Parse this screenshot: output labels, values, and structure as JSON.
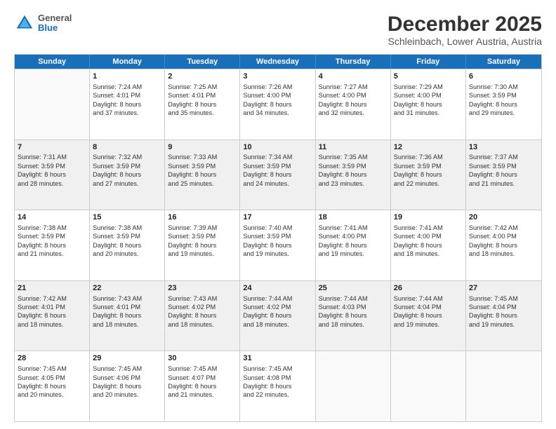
{
  "logo": {
    "general": "General",
    "blue": "Blue"
  },
  "title": "December 2025",
  "subtitle": "Schleinbach, Lower Austria, Austria",
  "weekdays": [
    "Sunday",
    "Monday",
    "Tuesday",
    "Wednesday",
    "Thursday",
    "Friday",
    "Saturday"
  ],
  "rows": [
    [
      {
        "day": "",
        "sunrise": "",
        "sunset": "",
        "daylight": "",
        "empty": true
      },
      {
        "day": "1",
        "sunrise": "Sunrise: 7:24 AM",
        "sunset": "Sunset: 4:01 PM",
        "daylight": "Daylight: 8 hours",
        "daylight2": "and 37 minutes."
      },
      {
        "day": "2",
        "sunrise": "Sunrise: 7:25 AM",
        "sunset": "Sunset: 4:01 PM",
        "daylight": "Daylight: 8 hours",
        "daylight2": "and 35 minutes."
      },
      {
        "day": "3",
        "sunrise": "Sunrise: 7:26 AM",
        "sunset": "Sunset: 4:00 PM",
        "daylight": "Daylight: 8 hours",
        "daylight2": "and 34 minutes."
      },
      {
        "day": "4",
        "sunrise": "Sunrise: 7:27 AM",
        "sunset": "Sunset: 4:00 PM",
        "daylight": "Daylight: 8 hours",
        "daylight2": "and 32 minutes."
      },
      {
        "day": "5",
        "sunrise": "Sunrise: 7:29 AM",
        "sunset": "Sunset: 4:00 PM",
        "daylight": "Daylight: 8 hours",
        "daylight2": "and 31 minutes."
      },
      {
        "day": "6",
        "sunrise": "Sunrise: 7:30 AM",
        "sunset": "Sunset: 3:59 PM",
        "daylight": "Daylight: 8 hours",
        "daylight2": "and 29 minutes."
      }
    ],
    [
      {
        "day": "7",
        "sunrise": "Sunrise: 7:31 AM",
        "sunset": "Sunset: 3:59 PM",
        "daylight": "Daylight: 8 hours",
        "daylight2": "and 28 minutes."
      },
      {
        "day": "8",
        "sunrise": "Sunrise: 7:32 AM",
        "sunset": "Sunset: 3:59 PM",
        "daylight": "Daylight: 8 hours",
        "daylight2": "and 27 minutes."
      },
      {
        "day": "9",
        "sunrise": "Sunrise: 7:33 AM",
        "sunset": "Sunset: 3:59 PM",
        "daylight": "Daylight: 8 hours",
        "daylight2": "and 25 minutes."
      },
      {
        "day": "10",
        "sunrise": "Sunrise: 7:34 AM",
        "sunset": "Sunset: 3:59 PM",
        "daylight": "Daylight: 8 hours",
        "daylight2": "and 24 minutes."
      },
      {
        "day": "11",
        "sunrise": "Sunrise: 7:35 AM",
        "sunset": "Sunset: 3:59 PM",
        "daylight": "Daylight: 8 hours",
        "daylight2": "and 23 minutes."
      },
      {
        "day": "12",
        "sunrise": "Sunrise: 7:36 AM",
        "sunset": "Sunset: 3:59 PM",
        "daylight": "Daylight: 8 hours",
        "daylight2": "and 22 minutes."
      },
      {
        "day": "13",
        "sunrise": "Sunrise: 7:37 AM",
        "sunset": "Sunset: 3:59 PM",
        "daylight": "Daylight: 8 hours",
        "daylight2": "and 21 minutes."
      }
    ],
    [
      {
        "day": "14",
        "sunrise": "Sunrise: 7:38 AM",
        "sunset": "Sunset: 3:59 PM",
        "daylight": "Daylight: 8 hours",
        "daylight2": "and 21 minutes."
      },
      {
        "day": "15",
        "sunrise": "Sunrise: 7:38 AM",
        "sunset": "Sunset: 3:59 PM",
        "daylight": "Daylight: 8 hours",
        "daylight2": "and 20 minutes."
      },
      {
        "day": "16",
        "sunrise": "Sunrise: 7:39 AM",
        "sunset": "Sunset: 3:59 PM",
        "daylight": "Daylight: 8 hours",
        "daylight2": "and 19 minutes."
      },
      {
        "day": "17",
        "sunrise": "Sunrise: 7:40 AM",
        "sunset": "Sunset: 3:59 PM",
        "daylight": "Daylight: 8 hours",
        "daylight2": "and 19 minutes."
      },
      {
        "day": "18",
        "sunrise": "Sunrise: 7:41 AM",
        "sunset": "Sunset: 4:00 PM",
        "daylight": "Daylight: 8 hours",
        "daylight2": "and 19 minutes."
      },
      {
        "day": "19",
        "sunrise": "Sunrise: 7:41 AM",
        "sunset": "Sunset: 4:00 PM",
        "daylight": "Daylight: 8 hours",
        "daylight2": "and 18 minutes."
      },
      {
        "day": "20",
        "sunrise": "Sunrise: 7:42 AM",
        "sunset": "Sunset: 4:00 PM",
        "daylight": "Daylight: 8 hours",
        "daylight2": "and 18 minutes."
      }
    ],
    [
      {
        "day": "21",
        "sunrise": "Sunrise: 7:42 AM",
        "sunset": "Sunset: 4:01 PM",
        "daylight": "Daylight: 8 hours",
        "daylight2": "and 18 minutes."
      },
      {
        "day": "22",
        "sunrise": "Sunrise: 7:43 AM",
        "sunset": "Sunset: 4:01 PM",
        "daylight": "Daylight: 8 hours",
        "daylight2": "and 18 minutes."
      },
      {
        "day": "23",
        "sunrise": "Sunrise: 7:43 AM",
        "sunset": "Sunset: 4:02 PM",
        "daylight": "Daylight: 8 hours",
        "daylight2": "and 18 minutes."
      },
      {
        "day": "24",
        "sunrise": "Sunrise: 7:44 AM",
        "sunset": "Sunset: 4:02 PM",
        "daylight": "Daylight: 8 hours",
        "daylight2": "and 18 minutes."
      },
      {
        "day": "25",
        "sunrise": "Sunrise: 7:44 AM",
        "sunset": "Sunset: 4:03 PM",
        "daylight": "Daylight: 8 hours",
        "daylight2": "and 18 minutes."
      },
      {
        "day": "26",
        "sunrise": "Sunrise: 7:44 AM",
        "sunset": "Sunset: 4:04 PM",
        "daylight": "Daylight: 8 hours",
        "daylight2": "and 19 minutes."
      },
      {
        "day": "27",
        "sunrise": "Sunrise: 7:45 AM",
        "sunset": "Sunset: 4:04 PM",
        "daylight": "Daylight: 8 hours",
        "daylight2": "and 19 minutes."
      }
    ],
    [
      {
        "day": "28",
        "sunrise": "Sunrise: 7:45 AM",
        "sunset": "Sunset: 4:05 PM",
        "daylight": "Daylight: 8 hours",
        "daylight2": "and 20 minutes."
      },
      {
        "day": "29",
        "sunrise": "Sunrise: 7:45 AM",
        "sunset": "Sunset: 4:06 PM",
        "daylight": "Daylight: 8 hours",
        "daylight2": "and 20 minutes."
      },
      {
        "day": "30",
        "sunrise": "Sunrise: 7:45 AM",
        "sunset": "Sunset: 4:07 PM",
        "daylight": "Daylight: 8 hours",
        "daylight2": "and 21 minutes."
      },
      {
        "day": "31",
        "sunrise": "Sunrise: 7:45 AM",
        "sunset": "Sunset: 4:08 PM",
        "daylight": "Daylight: 8 hours",
        "daylight2": "and 22 minutes."
      },
      {
        "day": "",
        "sunrise": "",
        "sunset": "",
        "daylight": "",
        "daylight2": "",
        "empty": true
      },
      {
        "day": "",
        "sunrise": "",
        "sunset": "",
        "daylight": "",
        "daylight2": "",
        "empty": true
      },
      {
        "day": "",
        "sunrise": "",
        "sunset": "",
        "daylight": "",
        "daylight2": "",
        "empty": true
      }
    ]
  ]
}
